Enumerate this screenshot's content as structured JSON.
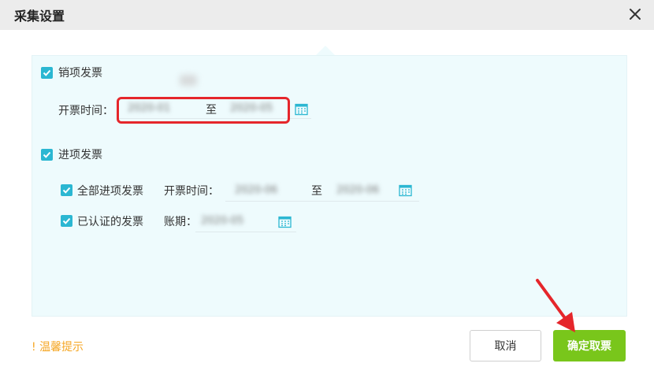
{
  "dialog": {
    "title": "采集设置"
  },
  "sales": {
    "checkbox_label": "销项发票",
    "checked": true,
    "date_label": "开票时间：",
    "start": "2020-01",
    "to": "至",
    "end": "2020-05"
  },
  "purchase": {
    "checkbox_label": "进项发票",
    "checked": true,
    "all": {
      "checkbox_label": "全部进项发票",
      "checked": true,
      "date_label": "开票时间：",
      "start": "2020-06",
      "to": "至",
      "end": "2020-06"
    },
    "certified": {
      "checkbox_label": "已认证的发票",
      "checked": true,
      "period_label": "账期：",
      "period": "2020-05"
    }
  },
  "footer": {
    "tip": "温馨提示",
    "cancel": "取消",
    "confirm": "确定取票"
  },
  "colors": {
    "accent": "#2bb7d2",
    "confirm": "#79c61b",
    "highlight": "#e5262b",
    "tip": "#f5a623"
  }
}
